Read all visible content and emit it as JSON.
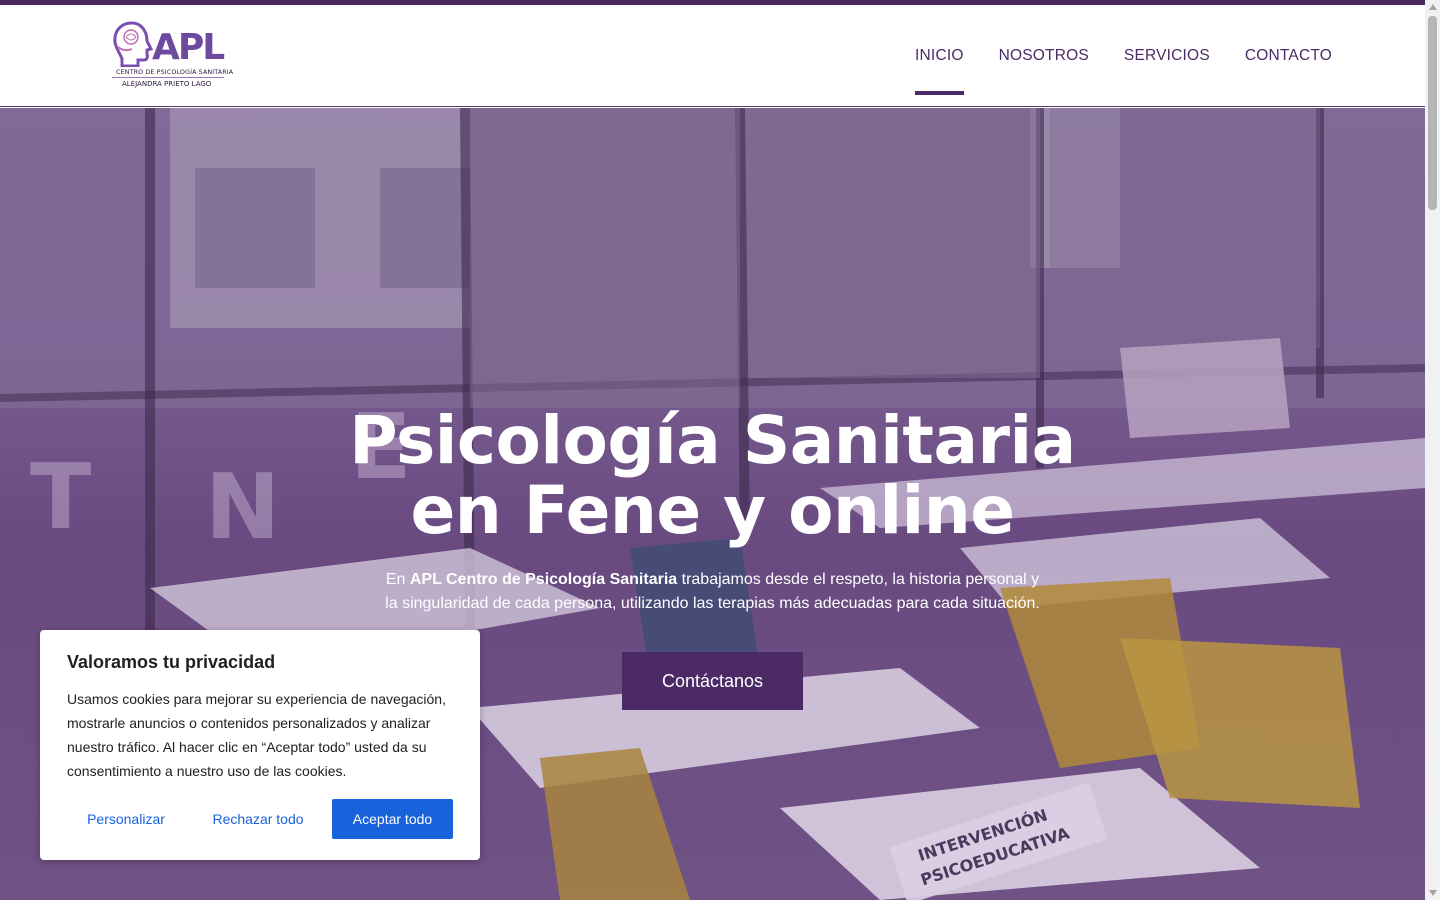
{
  "header": {
    "logo": {
      "mark": "APL",
      "line1": "CENTRO DE PSICOLOGÍA SANITARIA",
      "line2": "ALEJANDRA PRIETO LAGO"
    },
    "nav": [
      {
        "label": "INICIO",
        "active": true
      },
      {
        "label": "NOSOTROS",
        "active": false
      },
      {
        "label": "SERVICIOS",
        "active": false
      },
      {
        "label": "CONTACTO",
        "active": false
      }
    ]
  },
  "hero": {
    "title_line1": "Psicología Sanitaria",
    "title_line2": "en Fene y online",
    "text_prefix": "En ",
    "text_bold": "APL Centro de Psicología Sanitaria",
    "text_rest1": " trabajamos desde el respeto, la historia personal y",
    "text_line2": "la singularidad de cada persona, utilizando las terapias más adecuadas para cada situación.",
    "button_label": "Contáctanos",
    "sign_text_1": "INTERVENCIÓN",
    "sign_text_2": "PSICOEDUCATIVA"
  },
  "cookie": {
    "title": "Valoramos tu privacidad",
    "text": "Usamos cookies para mejorar su experiencia de navegación, mostrarle anuncios o contenidos personalizados y analizar nuestro tráfico. Al hacer clic en “Aceptar todo” usted da su consentimiento a nuestro uso de las cookies.",
    "customize_label": "Personalizar",
    "reject_label": "Rechazar todo",
    "accept_label": "Aceptar todo"
  },
  "colors": {
    "brand_purple": "#4b2a66",
    "overlay": "#58307a",
    "cookie_blue": "#1863dc"
  }
}
